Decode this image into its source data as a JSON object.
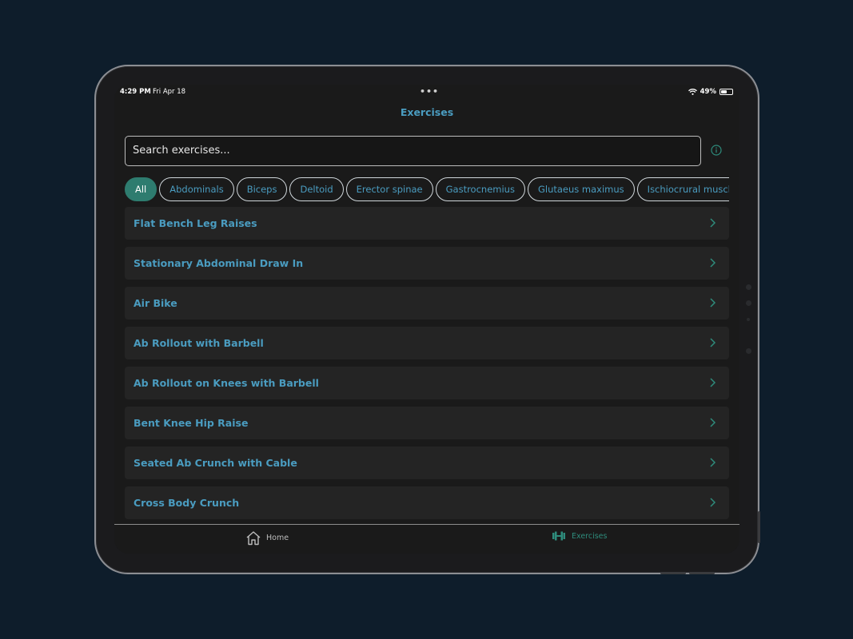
{
  "status": {
    "time": "4:29 PM",
    "date": "Fri Apr 18",
    "battery": "49%",
    "battery_level": 0.49
  },
  "nav": {
    "title": "Exercises"
  },
  "search": {
    "placeholder": "Search exercises..."
  },
  "chips": [
    "All",
    "Abdominals",
    "Biceps",
    "Deltoid",
    "Erector spinae",
    "Gastrocnemius",
    "Glutaeus maximus",
    "Ischiocrural muscles"
  ],
  "selected_chip": "All",
  "exercises": [
    "Flat Bench Leg Raises",
    "Stationary Abdominal Draw In",
    "Air Bike",
    "Ab Rollout with Barbell",
    "Ab Rollout on Knees with Barbell",
    "Bent Knee Hip Raise",
    "Seated Ab Crunch with Cable",
    "Cross Body Crunch"
  ],
  "tabs": {
    "home": "Home",
    "exercises": "Exercises",
    "active": "exercises"
  },
  "icons": {
    "info": "info-icon",
    "chevron": "chevron-right-icon",
    "home": "home-icon",
    "dumbbell": "dumbbell-icon",
    "wifi": "wifi-icon",
    "battery": "battery-icon"
  },
  "colors": {
    "accent": "#4a9cc0",
    "active_green": "#2e7c6f",
    "background": "#1a1a1a",
    "row": "#242424"
  }
}
